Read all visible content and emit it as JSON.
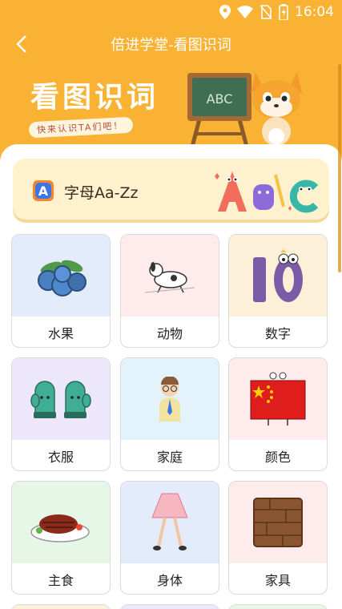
{
  "status_bar": {
    "time": "16:04",
    "icons": [
      "location-icon",
      "wifi-icon",
      "no-sim-icon",
      "battery-charging-icon"
    ]
  },
  "header": {
    "title": "倍进学堂-看图识词",
    "back_icon": "chevron-left-icon"
  },
  "banner": {
    "heading": "看图识词",
    "subtitle": "快来认识TA们吧！",
    "blackboard_text": "ABC"
  },
  "letters_card": {
    "label": "字母Aa-Zz",
    "icon_letter": "A"
  },
  "categories": [
    {
      "label": "水果",
      "bg": "#e4ecfb",
      "icon": "blueberries"
    },
    {
      "label": "动物",
      "bg": "#fdeceb",
      "icon": "dog"
    },
    {
      "label": "数字",
      "bg": "#fdf0d9",
      "icon": "number-ten"
    },
    {
      "label": "衣服",
      "bg": "#ede7fb",
      "icon": "mittens"
    },
    {
      "label": "家庭",
      "bg": "#e3f3fb",
      "icon": "grandpa"
    },
    {
      "label": "颜色",
      "bg": "#fdeceb",
      "icon": "flag"
    },
    {
      "label": "主食",
      "bg": "#e6f7e8",
      "icon": "steak"
    },
    {
      "label": "身体",
      "bg": "#e4ecfb",
      "icon": "legs-skirt"
    },
    {
      "label": "家具",
      "bg": "#fdeceb",
      "icon": "wood-board"
    }
  ],
  "colors": {
    "accent": "#f9b233",
    "card_bg": "#fdf2cd",
    "text": "#222222"
  }
}
